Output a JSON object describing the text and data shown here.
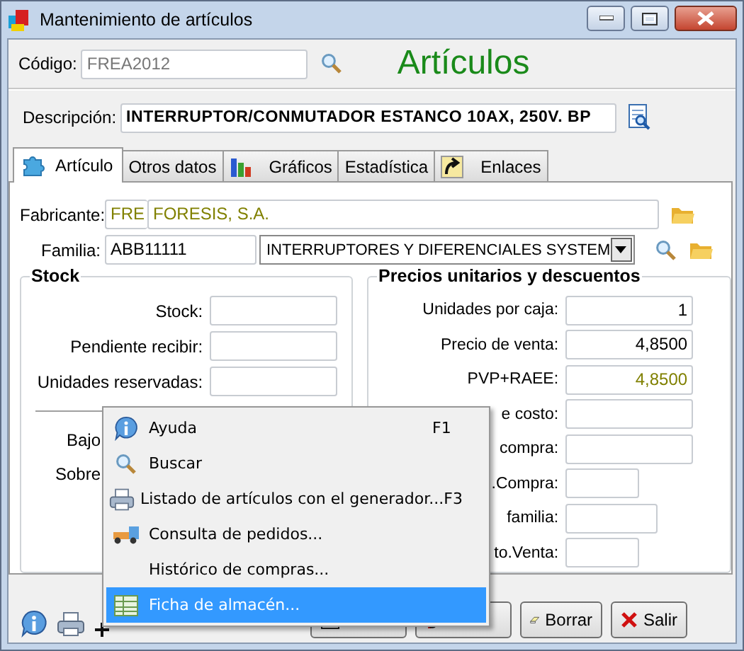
{
  "window": {
    "title": "Mantenimiento de artículos"
  },
  "header": {
    "code_label": "Código:",
    "code_value": "FREA2012",
    "heading": "Artículos",
    "description_label": "Descripción:",
    "description_value": "INTERRUPTOR/CONMUTADOR ESTANCO 10AX, 250V. BP"
  },
  "tabs": [
    {
      "label": "Artículo",
      "selected": true
    },
    {
      "label": "Otros datos",
      "selected": false
    },
    {
      "label": "Gráficos",
      "selected": false
    },
    {
      "label": "Estadística",
      "selected": false
    },
    {
      "label": "Enlaces",
      "selected": false
    }
  ],
  "manufacturer": {
    "label": "Fabricante:",
    "code": "FRE",
    "name": "FORESIS, S.A."
  },
  "family": {
    "label": "Familia:",
    "code": "ABB11111",
    "name": "INTERRUPTORES Y DIFERENCIALES SYSTEM"
  },
  "stock": {
    "title": "Stock",
    "rows": [
      {
        "label": "Stock:"
      },
      {
        "label": "Pendiente recibir:"
      },
      {
        "label": "Unidades reservadas:"
      }
    ],
    "lower_rows": [
      {
        "label": "Bajo"
      },
      {
        "label": "Sobre"
      }
    ]
  },
  "prices": {
    "title": "Precios unitarios y descuentos",
    "rows": [
      {
        "label": "Unidades por caja:",
        "value": "1",
        "derived": false
      },
      {
        "label": "Precio de venta:",
        "value": "4,8500",
        "derived": false
      },
      {
        "label": "PVP+RAEE:",
        "value": "4,8500",
        "derived": true
      },
      {
        "label": "e costo:"
      },
      {
        "label": "compra:"
      },
      {
        "label": ".Compra:"
      },
      {
        "label": "familia:"
      },
      {
        "label": "to.Venta:"
      }
    ]
  },
  "toolbar": {
    "buttons": [
      {
        "label": "Borrar"
      },
      {
        "label": "Salir"
      }
    ]
  },
  "context_menu": {
    "items": [
      {
        "label": "Ayuda",
        "shortcut": "F1",
        "selected": false
      },
      {
        "label": "Buscar",
        "selected": false
      },
      {
        "label": "Listado de artículos con el generador...",
        "shortcut": "F3",
        "selected": false
      },
      {
        "label": "Consulta de pedidos...",
        "selected": false
      },
      {
        "label": "Histórico de compras...",
        "selected": false
      },
      {
        "label": "Ficha de almacén...",
        "selected": true
      }
    ]
  }
}
